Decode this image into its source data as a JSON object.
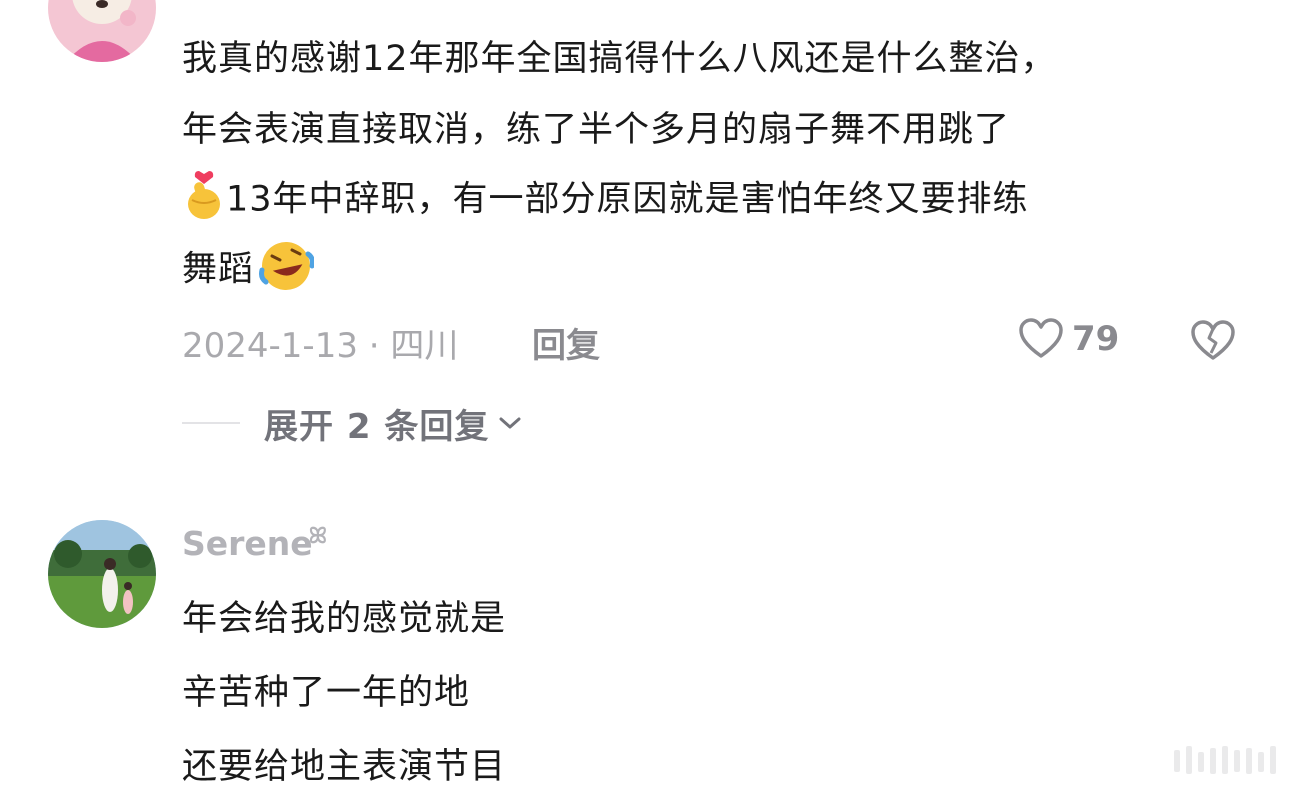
{
  "comments": [
    {
      "lines": [
        "我真的感谢12年那年全国搞得什么八风还是什么整治，",
        "年会表演直接取消，练了半个多月的扇子舞不用跳了",
        "13年中辞职，有一部分原因就是害怕年终又要排练",
        "舞蹈"
      ],
      "date_location": "2024-1-13 · 四川",
      "reply_label": "回复",
      "like_count": "79",
      "expand_label": "展开 2 条回复"
    },
    {
      "username": "Serene",
      "username_suffix": "ꕤ",
      "lines": [
        "年会给我的感觉就是",
        "辛苦种了一年的地",
        "还要给地主表演节目"
      ]
    }
  ],
  "icons": {
    "line3_prefix": "finger-heart-emoji",
    "line4_suffix": "rofl-emoji",
    "like": "heart-outline-icon",
    "dislike": "broken-heart-icon",
    "expand": "chevron-down-icon"
  },
  "colors": {
    "text": "#1a1a1a",
    "muted": "#a9a9ad",
    "action": "#8a8a8f"
  }
}
